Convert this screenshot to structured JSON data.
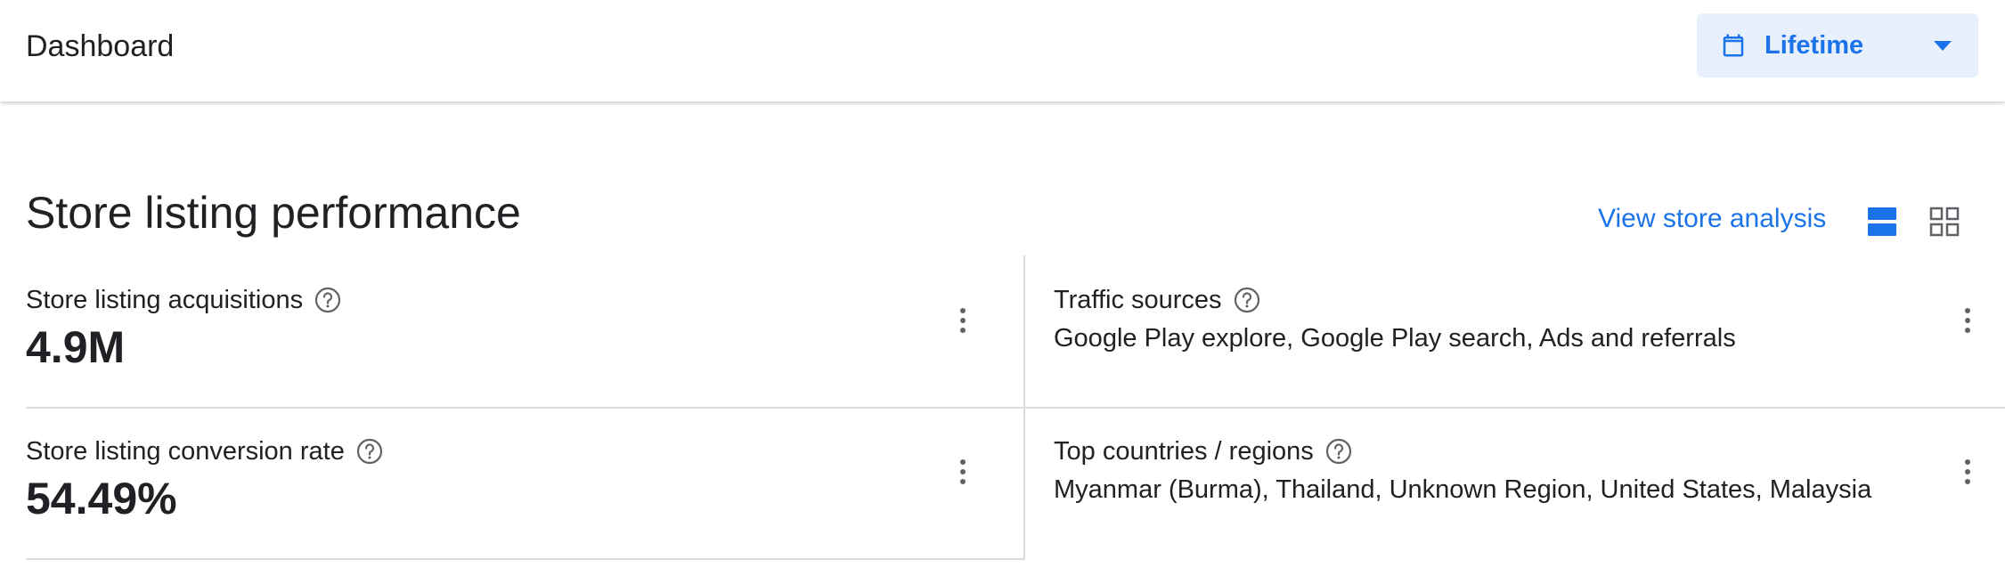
{
  "header": {
    "title": "Dashboard",
    "date_range": {
      "label": "Lifetime",
      "icon": "calendar-icon"
    }
  },
  "section": {
    "title": "Store listing performance",
    "view_link": "View store analysis",
    "view_toggle": {
      "options": [
        "list-view",
        "grid-view"
      ],
      "selected": "list-view"
    }
  },
  "metrics": [
    {
      "label": "Store listing acquisitions",
      "value": "4.9M"
    },
    {
      "label": "Traffic sources",
      "value": "Google Play explore, Google Play search, Ads and referrals"
    },
    {
      "label": "Store listing conversion rate",
      "value": "54.49%"
    },
    {
      "label": "Top countries / regions",
      "value": "Myanmar (Burma), Thailand, Unknown Region, United States, Malaysia"
    }
  ],
  "colors": {
    "accent": "#1a73e8",
    "picker_bg": "#e8f0fe",
    "divider": "#dadce0",
    "text": "#202124",
    "icon_grey": "#5f6368"
  }
}
